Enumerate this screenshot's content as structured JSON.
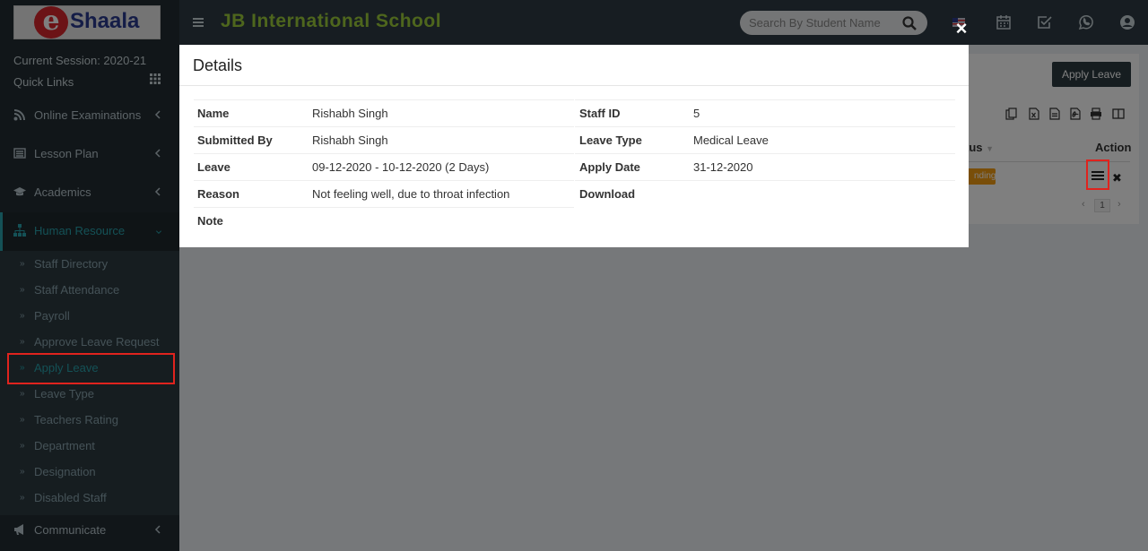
{
  "brand": {
    "logo_letter": "e",
    "logo_text": "Shaala"
  },
  "sidebar": {
    "session": "Current Session: 2020-21",
    "quick_links": "Quick Links",
    "menu": [
      {
        "label": "Online Examinations"
      },
      {
        "label": "Lesson Plan"
      },
      {
        "label": "Academics"
      },
      {
        "label": "Human Resource"
      }
    ],
    "submenu": [
      {
        "label": "Staff Directory"
      },
      {
        "label": "Staff Attendance"
      },
      {
        "label": "Payroll"
      },
      {
        "label": "Approve Leave Request"
      },
      {
        "label": "Apply Leave"
      },
      {
        "label": "Leave Type"
      },
      {
        "label": "Teachers Rating"
      },
      {
        "label": "Department"
      },
      {
        "label": "Designation"
      },
      {
        "label": "Disabled Staff"
      }
    ],
    "communicate": "Communicate"
  },
  "header": {
    "school_name": "JB International School",
    "search_placeholder": "Search By Student Name"
  },
  "content": {
    "apply_leave_button": "Apply Leave",
    "col_status": "tus",
    "col_action": "Action",
    "status_badge": "nding",
    "page_number": "1"
  },
  "modal": {
    "title": "Details",
    "close": "×",
    "left": [
      {
        "label": "Name",
        "value": "Rishabh Singh"
      },
      {
        "label": "Submitted By",
        "value": "Rishabh Singh"
      },
      {
        "label": "Leave",
        "value": "09-12-2020 - 10-12-2020 (2 Days)"
      },
      {
        "label": "Reason",
        "value": "Not feeling well, due to throat infection"
      },
      {
        "label": "Note",
        "value": ""
      }
    ],
    "right": [
      {
        "label": "Staff ID",
        "value": "5"
      },
      {
        "label": "Leave Type",
        "value": "Medical Leave"
      },
      {
        "label": "Apply Date",
        "value": "31-12-2020"
      },
      {
        "label": "Download",
        "value": ""
      }
    ]
  },
  "colors": {
    "accent": "#28a3ad",
    "school_name": "#9ccd3b",
    "highlight": "#e0231e",
    "pending": "#f39c12"
  }
}
